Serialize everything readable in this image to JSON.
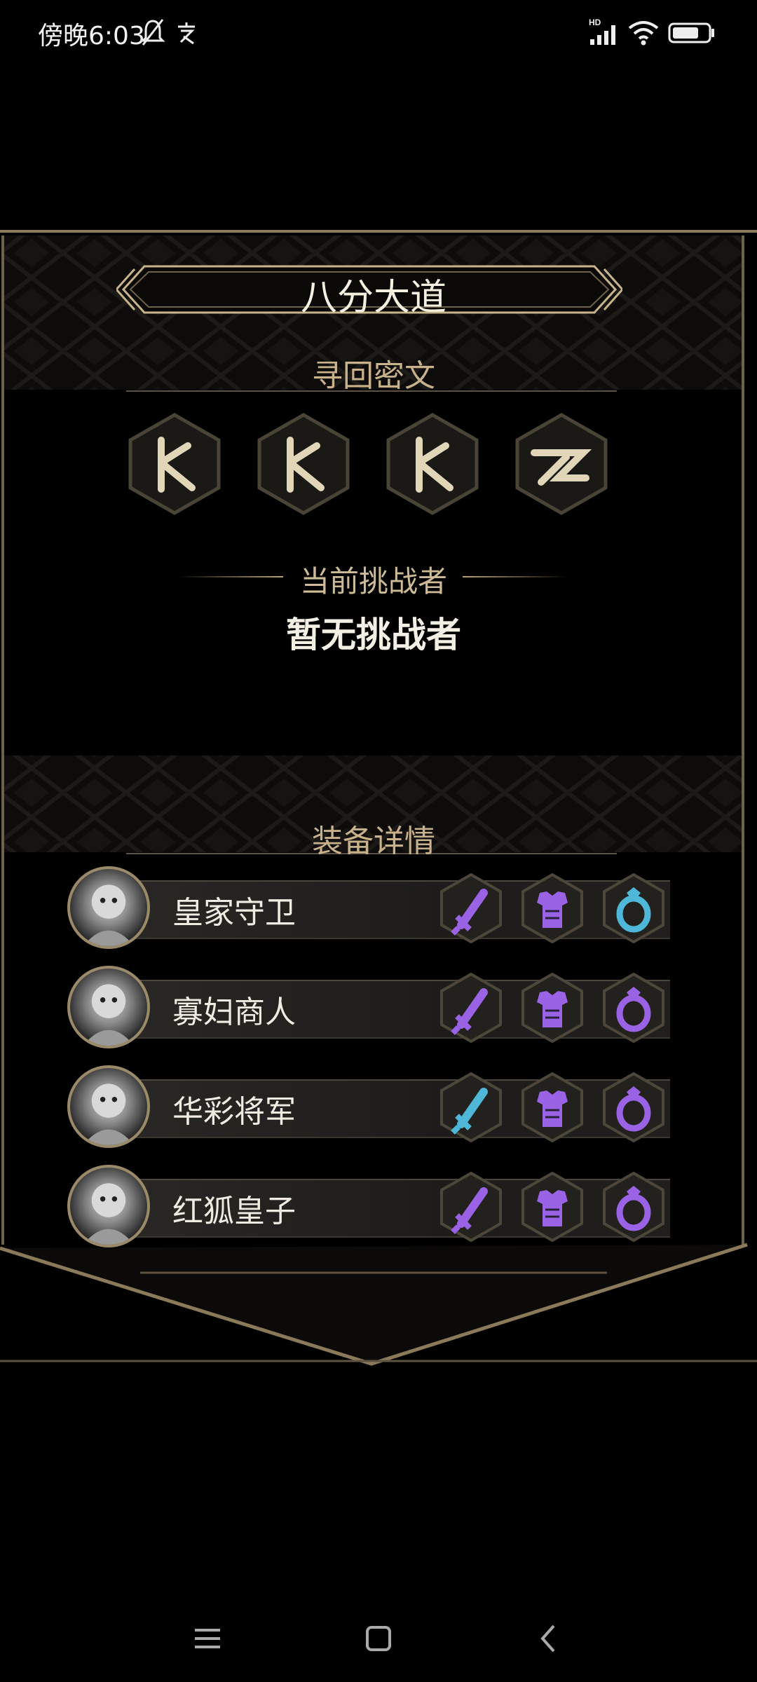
{
  "status_bar": {
    "time": "傍晚6:03",
    "icons": [
      "mute-bell-icon",
      "app-notification-icon",
      "hd-signal-icon",
      "wifi-icon",
      "battery-icon"
    ]
  },
  "panel": {
    "title": "八分大道",
    "runes_section_title": "寻回密文",
    "runes": [
      "rune-y-icon",
      "rune-y-icon",
      "rune-y-icon",
      "rune-zigzag-icon"
    ],
    "challenger_label": "当前挑战者",
    "challenger_value": "暂无挑战者",
    "equipment_section_title": "装备详情",
    "heroes": [
      {
        "name": "皇家守卫",
        "portrait": "royal-guard-portrait",
        "slots": [
          {
            "item": "sword-icon",
            "color": "#9a63e6"
          },
          {
            "item": "armor-icon",
            "color": "#9a63e6"
          },
          {
            "item": "ring-icon",
            "color": "#4fb8d9"
          }
        ]
      },
      {
        "name": "寡妇商人",
        "portrait": "widow-merchant-portrait",
        "slots": [
          {
            "item": "sword-icon",
            "color": "#9a63e6"
          },
          {
            "item": "armor-icon",
            "color": "#9a63e6"
          },
          {
            "item": "ring-icon",
            "color": "#9a63e6"
          }
        ]
      },
      {
        "name": "华彩将军",
        "portrait": "colorful-general-portrait",
        "slots": [
          {
            "item": "sword-icon",
            "color": "#4fb8d9"
          },
          {
            "item": "armor-icon",
            "color": "#9a63e6"
          },
          {
            "item": "ring-icon",
            "color": "#9a63e6"
          }
        ]
      },
      {
        "name": "红狐皇子",
        "portrait": "red-fox-prince-portrait",
        "slots": [
          {
            "item": "sword-icon",
            "color": "#9a63e6"
          },
          {
            "item": "armor-icon",
            "color": "#9a63e6"
          },
          {
            "item": "ring-icon",
            "color": "#9a63e6"
          }
        ]
      }
    ]
  },
  "nav_bar": {
    "buttons": [
      "menu-icon",
      "home-icon",
      "back-icon"
    ]
  }
}
